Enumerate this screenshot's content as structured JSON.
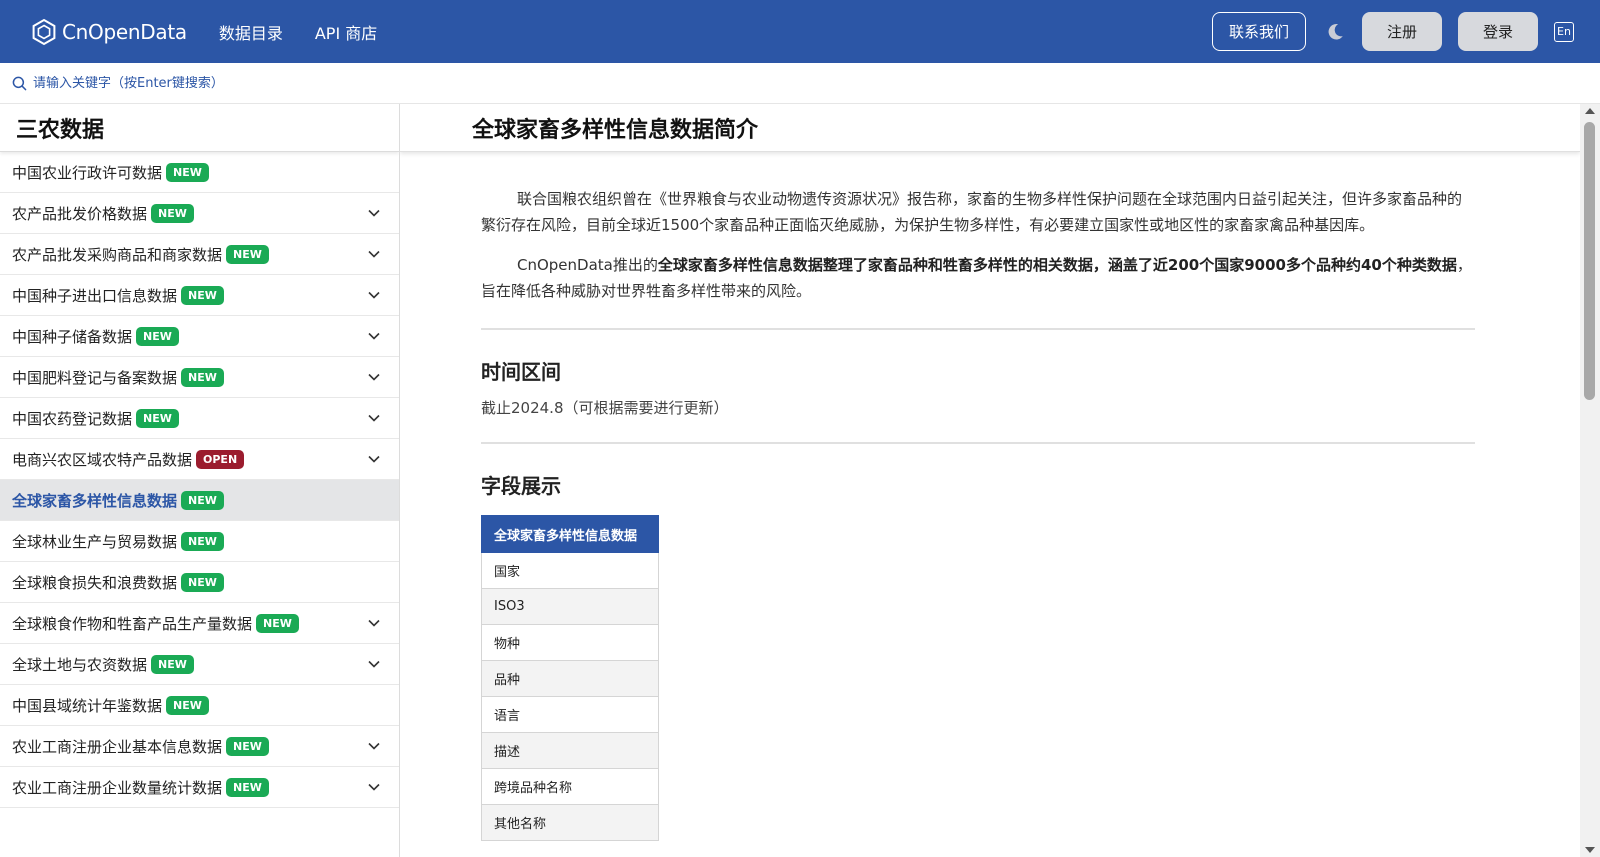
{
  "header": {
    "logo_text": "CnOpenData",
    "nav": [
      "数据目录",
      "API 商店"
    ],
    "contact_label": "联系我们",
    "register_label": "注册",
    "login_label": "登录",
    "lang_label": "En",
    "icons": {
      "logo": "hexagon-logo-icon",
      "theme": "moon-icon"
    }
  },
  "search": {
    "placeholder": "请输入关键字（按Enter键搜索）",
    "icon": "search-icon"
  },
  "sidebar": {
    "title": "三农数据",
    "items": [
      {
        "label": "中国农业行政许可数据",
        "badge": "NEW",
        "badge_type": "new",
        "expandable": false,
        "active": false
      },
      {
        "label": "农产品批发价格数据",
        "badge": "NEW",
        "badge_type": "new",
        "expandable": true,
        "active": false
      },
      {
        "label": "农产品批发采购商品和商家数据",
        "badge": "NEW",
        "badge_type": "new",
        "expandable": true,
        "active": false
      },
      {
        "label": "中国种子进出口信息数据",
        "badge": "NEW",
        "badge_type": "new",
        "expandable": true,
        "active": false
      },
      {
        "label": "中国种子储备数据",
        "badge": "NEW",
        "badge_type": "new",
        "expandable": true,
        "active": false
      },
      {
        "label": "中国肥料登记与备案数据",
        "badge": "NEW",
        "badge_type": "new",
        "expandable": true,
        "active": false
      },
      {
        "label": "中国农药登记数据",
        "badge": "NEW",
        "badge_type": "new",
        "expandable": true,
        "active": false
      },
      {
        "label": "电商兴农区域农特产品数据",
        "badge": "OPEN",
        "badge_type": "open",
        "expandable": true,
        "active": false
      },
      {
        "label": "全球家畜多样性信息数据",
        "badge": "NEW",
        "badge_type": "new",
        "expandable": false,
        "active": true
      },
      {
        "label": "全球林业生产与贸易数据",
        "badge": "NEW",
        "badge_type": "new",
        "expandable": false,
        "active": false
      },
      {
        "label": "全球粮食损失和浪费数据",
        "badge": "NEW",
        "badge_type": "new",
        "expandable": false,
        "active": false
      },
      {
        "label": "全球粮食作物和牲畜产品生产量数据",
        "badge": "NEW",
        "badge_type": "new",
        "expandable": true,
        "active": false
      },
      {
        "label": "全球土地与农资数据",
        "badge": "NEW",
        "badge_type": "new",
        "expandable": true,
        "active": false
      },
      {
        "label": "中国县域统计年鉴数据",
        "badge": "NEW",
        "badge_type": "new",
        "expandable": false,
        "active": false
      },
      {
        "label": "农业工商注册企业基本信息数据",
        "badge": "NEW",
        "badge_type": "new",
        "expandable": true,
        "active": false
      },
      {
        "label": "农业工商注册企业数量统计数据",
        "badge": "NEW",
        "badge_type": "new",
        "expandable": true,
        "active": false
      }
    ]
  },
  "main": {
    "title": "全球家畜多样性信息数据简介",
    "para1": "联合国粮农组织曾在《世界粮食与农业动物遗传资源状况》报告称，家畜的生物多样性保护问题在全球范围内日益引起关注，但许多家畜品种的繁衍存在风险，目前全球近1500个家畜品种正面临灭绝威胁，为保护生物多样性，有必要建立国家性或地区性的家畜家禽品种基因库。",
    "para2_prefix": "CnOpenData推出的",
    "para2_bold": "全球家畜多样性信息数据整理了家畜品种和牲畜多样性的相关数据，涵盖了近200个国家9000多个品种约40个种类数据",
    "para2_suffix": "，旨在降低各种威胁对世界牲畜多样性带来的风险。",
    "time_title": "时间区间",
    "time_text": "截止2024.8（可根据需要进行更新）",
    "fields_title": "字段展示",
    "table_header": "全球家畜多样性信息数据",
    "fields": [
      "国家",
      "ISO3",
      "物种",
      "品种",
      "语言",
      "描述",
      "跨境品种名称",
      "其他名称"
    ]
  },
  "colors": {
    "brand": "#2c56a6",
    "badge_new": "#1aaa55",
    "badge_open": "#9b1c2e"
  }
}
